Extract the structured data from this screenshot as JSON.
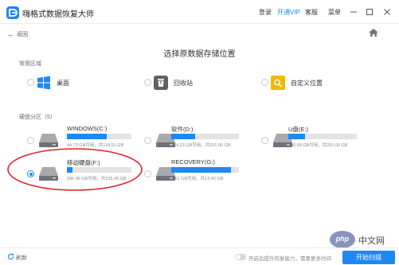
{
  "titlebar": {
    "title": "嗨格式数据恢复大师",
    "login": "登录",
    "vip": "开通VIP",
    "service": "客服",
    "menu": "菜单"
  },
  "nav": {
    "back": "返回"
  },
  "page_title": "选择原数据存储位置",
  "sections": {
    "common": "常用区域",
    "disk": "硬盘分区（5）"
  },
  "locations": [
    {
      "label": "桌面",
      "icon": "windows-icon"
    },
    {
      "label": "回收站",
      "icon": "recycle-bin-icon"
    },
    {
      "label": "自定义位置",
      "icon": "folder-search-icon"
    }
  ],
  "drives": [
    {
      "name": "WINDOWS(C:)",
      "info": "44.73 GB可用，共118.01 GB",
      "used": 0.62,
      "selected": false
    },
    {
      "name": "软件(D:)",
      "info": "164.23 GB可用，共251.00 GB",
      "used": 0.35,
      "selected": false
    },
    {
      "name": "U盘(E:)",
      "info": "190.09 GB可用，共251.00 GB",
      "used": 0.24,
      "selected": false
    },
    {
      "name": "移动硬盘(F:)",
      "info": "286.99 GB可用，共315.09 GB",
      "used": 0.09,
      "selected": true
    },
    {
      "name": "RECOVERY(G:)",
      "info": "1.61 GB可用，共13.42 GB",
      "used": 0.88,
      "selected": false
    }
  ],
  "watermark": {
    "badge": "php",
    "text": "中文网"
  },
  "bottombar": {
    "refresh": "刷新",
    "toggle_text": "开启后提升恢复能力，需要更多时间",
    "scan": "开始扫描"
  },
  "colors": {
    "accent": "#1e88f3",
    "annotation": "#d9262b"
  }
}
